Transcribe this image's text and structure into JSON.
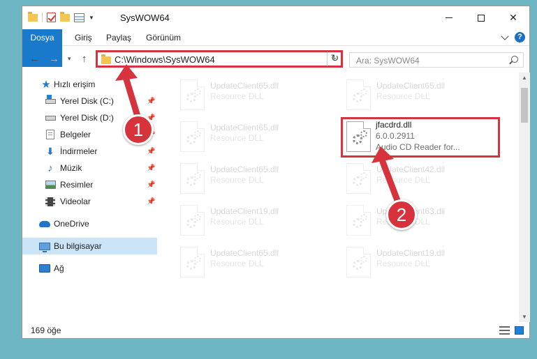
{
  "window": {
    "title": "SysWOW64"
  },
  "ribbon": {
    "tabs": [
      "Dosya",
      "Giriş",
      "Paylaş",
      "Görünüm"
    ]
  },
  "address": {
    "path": "C:\\Windows\\SysWOW64"
  },
  "search": {
    "placeholder": "Ara: SysWOW64"
  },
  "sidebar": {
    "items": [
      {
        "label": "Hızlı erişim",
        "icon": "star-icon"
      },
      {
        "label": "Yerel Disk (C:)",
        "icon": "drive-c-icon",
        "pinned": true
      },
      {
        "label": "Yerel Disk (D:)",
        "icon": "drive-d-icon",
        "pinned": true
      },
      {
        "label": "Belgeler",
        "icon": "documents-icon",
        "pinned": true
      },
      {
        "label": "İndirmeler",
        "icon": "downloads-icon",
        "pinned": true
      },
      {
        "label": "Müzik",
        "icon": "music-icon",
        "pinned": true
      },
      {
        "label": "Resimler",
        "icon": "pictures-icon",
        "pinned": true
      },
      {
        "label": "Videolar",
        "icon": "videos-icon",
        "pinned": true
      },
      {
        "label": "OneDrive",
        "icon": "onedrive-icon"
      },
      {
        "label": "Bu bilgisayar",
        "icon": "this-pc-icon",
        "selected": true
      },
      {
        "label": "Ağ",
        "icon": "network-icon"
      }
    ]
  },
  "files": [
    {
      "name": "UpdateClient65.dll",
      "line1": "Resource DLL",
      "line2": ""
    },
    {
      "name": "UpdateClient65.dll",
      "line1": "Resource DLL",
      "line2": ""
    },
    {
      "name": "UpdateClient65.dll",
      "line1": "Resource DLL",
      "line2": ""
    },
    {
      "name": "jfacdrd.dll",
      "line1": "6.0.0.2911",
      "line2": "Audio CD Reader for..."
    },
    {
      "name": "UpdateClient65.dll",
      "line1": "Resource DLL",
      "line2": ""
    },
    {
      "name": "UpdateClient42.dll",
      "line1": "Resource DLL",
      "line2": ""
    },
    {
      "name": "UpdateClient19.dll",
      "line1": "Resource DLL",
      "line2": ""
    },
    {
      "name": "UpdateClient63.dll",
      "line1": "Resource DLL",
      "line2": ""
    },
    {
      "name": "UpdateClient65.dll",
      "line1": "Resource DLL",
      "line2": ""
    },
    {
      "name": "UpdateClient19.dll",
      "line1": "Resource DLL",
      "line2": ""
    }
  ],
  "status": {
    "item_count": "169 öğe"
  },
  "callouts": {
    "step1": "1",
    "step2": "2"
  },
  "colors": {
    "accent": "#1979ca",
    "highlight": "#d7333d",
    "selected_bg": "#cce4f7"
  }
}
